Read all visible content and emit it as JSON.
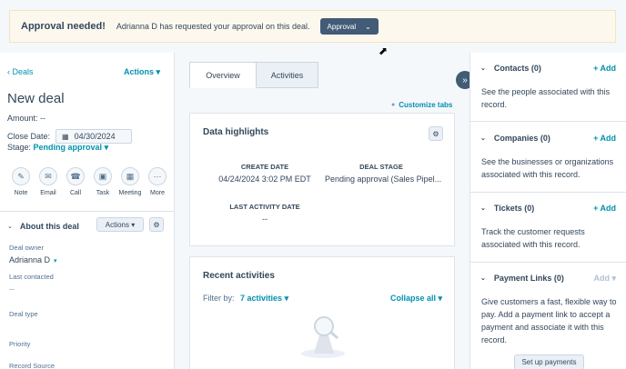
{
  "banner": {
    "title": "Approval needed!",
    "text": "Adrianna D has requested your approval on this deal.",
    "button_label": "Approval"
  },
  "left": {
    "back_label": "Deals",
    "actions_label": "Actions",
    "deal_name": "New deal",
    "amount_label": "Amount:",
    "amount_value": "--",
    "close_date_label": "Close Date:",
    "close_date_value": "04/30/2024",
    "stage_label": "Stage:",
    "stage_value": "Pending approval",
    "quick_actions": [
      "Note",
      "Email",
      "Call",
      "Task",
      "Meeting",
      "More"
    ],
    "about": {
      "title": "About this deal",
      "actions_label": "Actions"
    },
    "properties": {
      "deal_owner_label": "Deal owner",
      "deal_owner_value": "Adrianna D",
      "last_contacted_label": "Last contacted",
      "last_contacted_value": "--",
      "deal_type_label": "Deal type",
      "priority_label": "Priority",
      "record_source_label": "Record Source"
    }
  },
  "middle": {
    "tabs": [
      {
        "label": "Overview",
        "active": true
      },
      {
        "label": "Activities",
        "active": false
      }
    ],
    "customize_label": "Customize tabs",
    "highlights": {
      "title": "Data highlights",
      "create_date_label": "CREATE DATE",
      "create_date_value": "04/24/2024 3:02 PM EDT",
      "deal_stage_label": "DEAL STAGE",
      "deal_stage_value": "Pending approval (Sales Pipel...",
      "last_activity_label": "LAST ACTIVITY DATE",
      "last_activity_value": "--"
    },
    "recent": {
      "title": "Recent activities",
      "filter_label": "Filter by:",
      "filter_value": "7 activities",
      "collapse_label": "Collapse all"
    }
  },
  "right": {
    "sections": [
      {
        "title": "Contacts (0)",
        "add_label": "+ Add",
        "desc": "See the people associated with this record."
      },
      {
        "title": "Companies (0)",
        "add_label": "+ Add",
        "desc": "See the businesses or organizations associated with this record."
      },
      {
        "title": "Tickets (0)",
        "add_label": "+ Add",
        "desc": "Track the customer requests associated with this record."
      },
      {
        "title": "Payment Links (0)",
        "add_label": "Add",
        "desc": "Give customers a fast, flexible way to pay. Add a payment link to accept a payment and associate it with this record."
      }
    ],
    "setup_label": "Set up payments"
  },
  "colors": {
    "accent": "#0091ae",
    "dark_button": "#425b76",
    "banner_bg": "#fdf8ee"
  }
}
